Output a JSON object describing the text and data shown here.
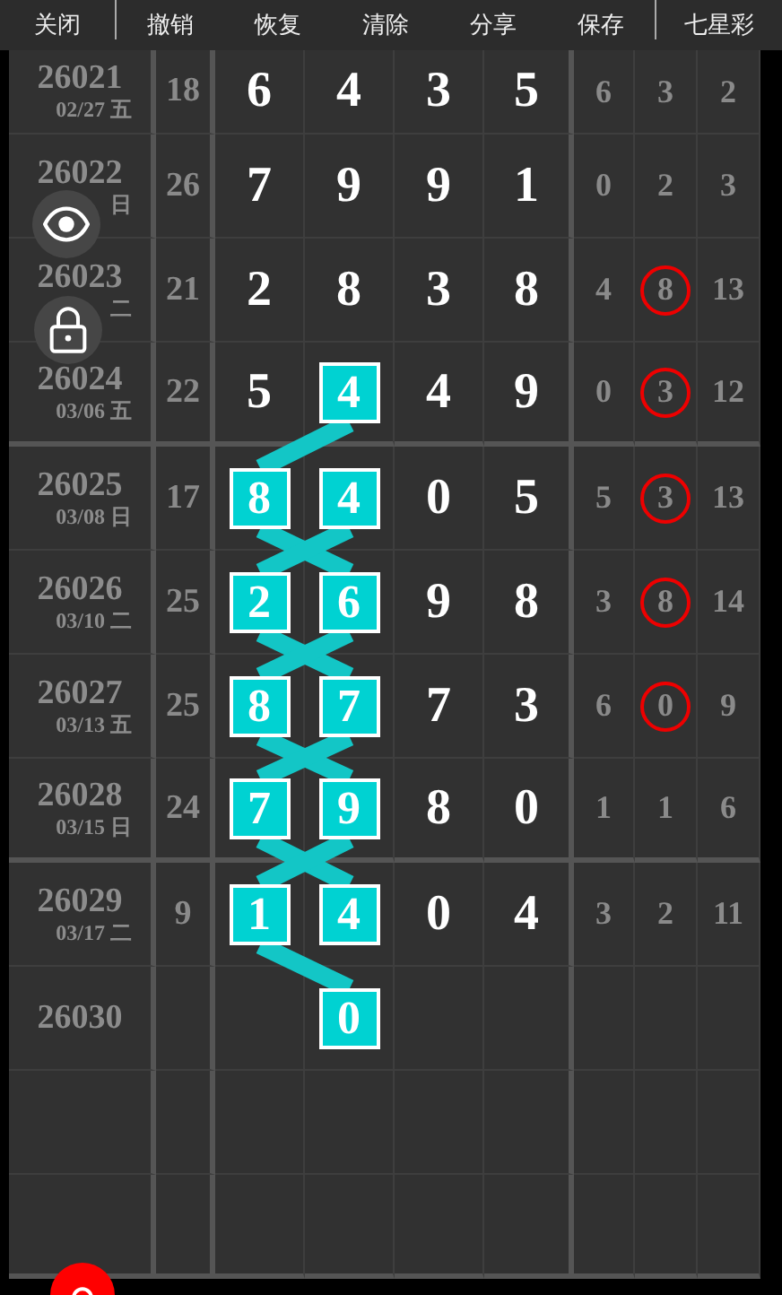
{
  "toolbar": {
    "left": "关闭",
    "actions": [
      "撤销",
      "恢复",
      "清除",
      "分享",
      "保存"
    ],
    "title": "七星彩"
  },
  "rows": [
    {
      "issue": "26021",
      "date": "02/27 五",
      "sum": "18",
      "digits": [
        {
          "value": "6",
          "highlighted": false
        },
        {
          "value": "4",
          "highlighted": false
        },
        {
          "value": "3",
          "highlighted": false
        },
        {
          "value": "5",
          "highlighted": false
        }
      ],
      "extras": [
        {
          "value": "6",
          "circled": false
        },
        {
          "value": "3",
          "circled": false
        },
        {
          "value": "2",
          "circled": false
        }
      ]
    },
    {
      "issue": "26022",
      "date": "日",
      "sum": "26",
      "digits": [
        {
          "value": "7",
          "highlighted": false
        },
        {
          "value": "9",
          "highlighted": false
        },
        {
          "value": "9",
          "highlighted": false
        },
        {
          "value": "1",
          "highlighted": false
        }
      ],
      "extras": [
        {
          "value": "0",
          "circled": false
        },
        {
          "value": "2",
          "circled": false
        },
        {
          "value": "3",
          "circled": false
        }
      ]
    },
    {
      "issue": "26023",
      "date": "二",
      "sum": "21",
      "digits": [
        {
          "value": "2",
          "highlighted": false
        },
        {
          "value": "8",
          "highlighted": false
        },
        {
          "value": "3",
          "highlighted": false
        },
        {
          "value": "8",
          "highlighted": false
        }
      ],
      "extras": [
        {
          "value": "4",
          "circled": false
        },
        {
          "value": "8",
          "circled": true
        },
        {
          "value": "13",
          "circled": false
        }
      ]
    },
    {
      "issue": "26024",
      "date": "03/06 五",
      "sum": "22",
      "digits": [
        {
          "value": "5",
          "highlighted": false
        },
        {
          "value": "4",
          "highlighted": true
        },
        {
          "value": "4",
          "highlighted": false
        },
        {
          "value": "9",
          "highlighted": false
        }
      ],
      "extras": [
        {
          "value": "0",
          "circled": false
        },
        {
          "value": "3",
          "circled": true
        },
        {
          "value": "12",
          "circled": false
        }
      ]
    },
    {
      "issue": "26025",
      "date": "03/08 日",
      "sum": "17",
      "digits": [
        {
          "value": "8",
          "highlighted": true
        },
        {
          "value": "4",
          "highlighted": true
        },
        {
          "value": "0",
          "highlighted": false
        },
        {
          "value": "5",
          "highlighted": false
        }
      ],
      "extras": [
        {
          "value": "5",
          "circled": false
        },
        {
          "value": "3",
          "circled": true
        },
        {
          "value": "13",
          "circled": false
        }
      ]
    },
    {
      "issue": "26026",
      "date": "03/10 二",
      "sum": "25",
      "digits": [
        {
          "value": "2",
          "highlighted": true
        },
        {
          "value": "6",
          "highlighted": true
        },
        {
          "value": "9",
          "highlighted": false
        },
        {
          "value": "8",
          "highlighted": false
        }
      ],
      "extras": [
        {
          "value": "3",
          "circled": false
        },
        {
          "value": "8",
          "circled": true
        },
        {
          "value": "14",
          "circled": false
        }
      ]
    },
    {
      "issue": "26027",
      "date": "03/13 五",
      "sum": "25",
      "digits": [
        {
          "value": "8",
          "highlighted": true
        },
        {
          "value": "7",
          "highlighted": true
        },
        {
          "value": "7",
          "highlighted": false
        },
        {
          "value": "3",
          "highlighted": false
        }
      ],
      "extras": [
        {
          "value": "6",
          "circled": false
        },
        {
          "value": "0",
          "circled": true
        },
        {
          "value": "9",
          "circled": false
        }
      ]
    },
    {
      "issue": "26028",
      "date": "03/15 日",
      "sum": "24",
      "digits": [
        {
          "value": "7",
          "highlighted": true
        },
        {
          "value": "9",
          "highlighted": true
        },
        {
          "value": "8",
          "highlighted": false
        },
        {
          "value": "0",
          "highlighted": false
        }
      ],
      "extras": [
        {
          "value": "1",
          "circled": false
        },
        {
          "value": "1",
          "circled": false
        },
        {
          "value": "6",
          "circled": false
        }
      ]
    },
    {
      "issue": "26029",
      "date": "03/17 二",
      "sum": "9",
      "digits": [
        {
          "value": "1",
          "highlighted": true
        },
        {
          "value": "4",
          "highlighted": true
        },
        {
          "value": "0",
          "highlighted": false
        },
        {
          "value": "4",
          "highlighted": false
        }
      ],
      "extras": [
        {
          "value": "3",
          "circled": false
        },
        {
          "value": "2",
          "circled": false
        },
        {
          "value": "11",
          "circled": false
        }
      ]
    },
    {
      "issue": "26030",
      "digits": [
        {
          "highlighted": false
        },
        {
          "value": "0",
          "highlighted": true
        },
        {
          "highlighted": false
        },
        {
          "highlighted": false
        }
      ]
    }
  ]
}
